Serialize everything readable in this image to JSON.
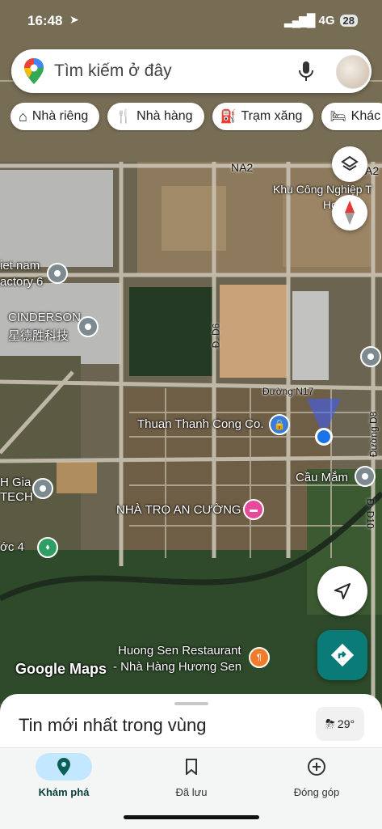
{
  "status": {
    "time": "16:48",
    "network": "4G",
    "battery": "28"
  },
  "search": {
    "placeholder": "Tìm kiếm ở đây"
  },
  "chips": [
    {
      "icon": "home-icon",
      "label": "Nhà riêng"
    },
    {
      "icon": "restaurant-icon",
      "label": "Nhà hàng"
    },
    {
      "icon": "gas-station-icon",
      "label": "Trạm xăng"
    },
    {
      "icon": "hotel-icon",
      "label": "Khác"
    }
  ],
  "map_labels": {
    "road_na2": "NA2",
    "road_na2_right": "A2",
    "kcn": "Khu Công Nghiệp T",
    "kcn2": "Hoà (N",
    "vietnam": "iet nam",
    "factory": "actory 6",
    "cinderson": "CINDERSON",
    "cinderson_cn": "星德胜科技",
    "d6": "Đ. D6",
    "n17": "Đường N17",
    "d8": "Đường D8",
    "d10": "Đ. D10",
    "thuan_thanh": "Thuan Thanh Cong Co.",
    "cau_mam": "Cầu Mắm",
    "h_gia": "H Gia",
    "tech": "TECH",
    "nha_tro": "NHÀ TRỌ AN CƯỜNG",
    "nuoc4": "ớc 4",
    "huong_sen1": "Huong Sen Restaurant",
    "huong_sen2": "- Nhà Hàng Hương Sen",
    "google_maps": "Google Maps"
  },
  "sheet": {
    "title": "Tin mới nhất trong vùng",
    "temperature": "29°"
  },
  "nav": {
    "tabs": [
      {
        "label": "Khám phá",
        "icon": "location-pin-icon",
        "active": true
      },
      {
        "label": "Đã lưu",
        "icon": "bookmark-icon",
        "active": false
      },
      {
        "label": "Đóng góp",
        "icon": "add-circle-icon",
        "active": false
      }
    ]
  },
  "colors": {
    "accent": "#1a73e8",
    "nav_active": "#c3e7ff",
    "direction_fab": "#0b7b78",
    "location_dot": "#1a73e8"
  }
}
